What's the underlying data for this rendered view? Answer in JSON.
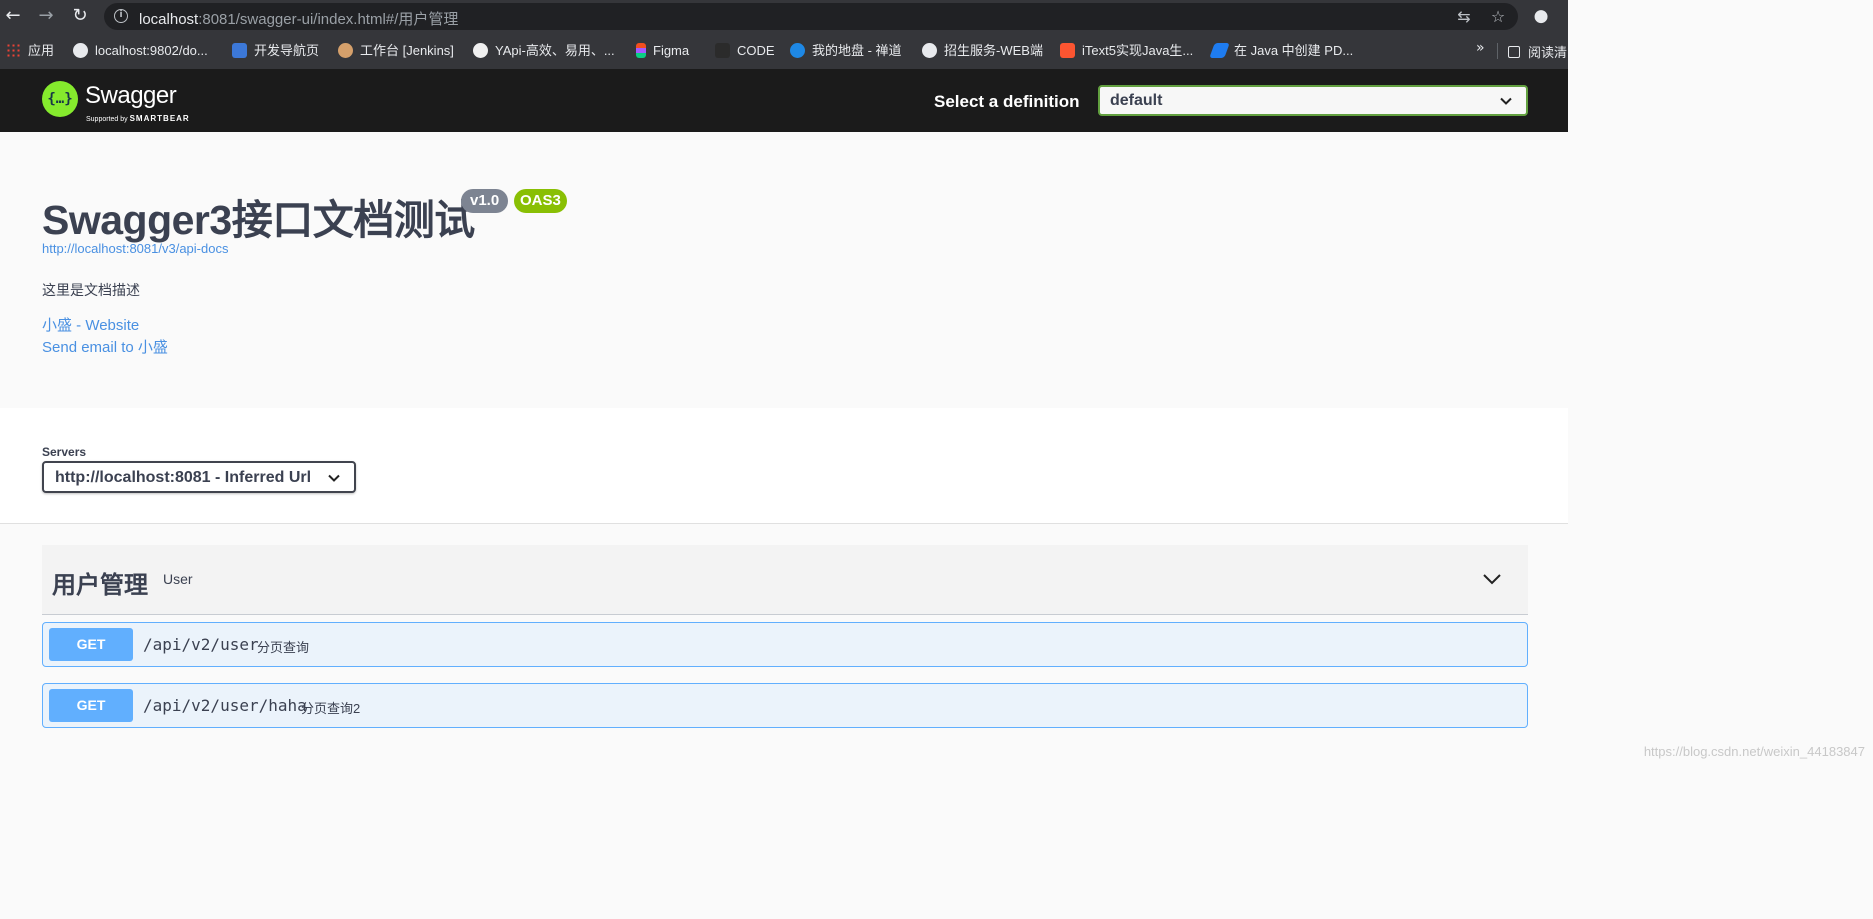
{
  "browser": {
    "nav": {
      "back_icon": "←",
      "forward_icon": "→",
      "reload_icon": "↻"
    },
    "url_host": "localhost",
    "url_rest": ":8081/swagger-ui/index.html#/用户管理",
    "translate_icon": "⇆",
    "star_icon": "☆",
    "profile_icon": "●",
    "bookmarks": [
      {
        "label": "应用",
        "color": "#e8710a"
      },
      {
        "label": "localhost:9802/do...",
        "color": "#e8eaed"
      },
      {
        "label": "开发导航页",
        "color": "#3c78d8"
      },
      {
        "label": "工作台 [Jenkins]",
        "color": "#d5a06b"
      },
      {
        "label": "YApi-高效、易用、...",
        "color": "#f0f0f0"
      },
      {
        "label": "Figma",
        "color": "#f24e1e"
      },
      {
        "label": "CODE",
        "color": "#2b2b2b"
      },
      {
        "label": "我的地盘 - 禅道",
        "color": "#1e88e5"
      },
      {
        "label": "招生服务-WEB端",
        "color": "#e8eaed"
      },
      {
        "label": "iText5实现Java生...",
        "color": "#fc5531"
      },
      {
        "label": "在 Java 中创建 PD...",
        "color": "#1e7cf0"
      }
    ],
    "more_label": "»",
    "reading_list": "阅读清"
  },
  "topbar": {
    "logo_text": "Swagger",
    "logo_sub_a": "Supported by ",
    "logo_sub_b": "SMARTBEAR",
    "definition_label": "Select a definition",
    "definition_value": "default"
  },
  "info": {
    "title": "Swagger3接口文档测试",
    "version": "v1.0",
    "oas": "OAS3",
    "spec_url": "http://localhost:8081/v3/api-docs",
    "description": "这里是文档描述",
    "website_link": "小盛 - Website",
    "email_link": "Send email to 小盛"
  },
  "servers": {
    "label": "Servers",
    "selected": "http://localhost:8081 - Inferred Url"
  },
  "tag": {
    "name": "用户管理",
    "description": "User"
  },
  "operations": [
    {
      "method": "GET",
      "path": "/api/v2/user",
      "summary": "分页查询"
    },
    {
      "method": "GET",
      "path": "/api/v2/user/haha",
      "summary": "分页查询2"
    }
  ],
  "watermark": "https://blog.csdn.net/weixin_44183847"
}
